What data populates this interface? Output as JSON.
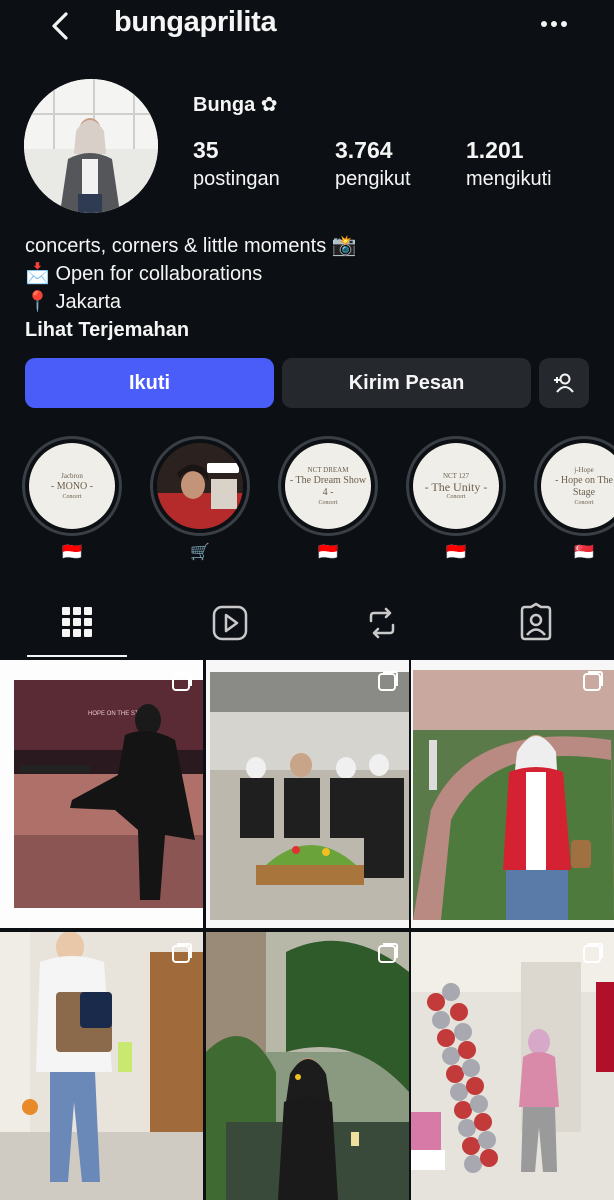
{
  "header": {
    "username": "bungaprilita"
  },
  "profile": {
    "display_name": "Bunga ✿",
    "stats": [
      {
        "value": "35",
        "label": "postingan"
      },
      {
        "value": "3.764",
        "label": "pengikut"
      },
      {
        "value": "1.201",
        "label": "mengikuti"
      }
    ],
    "bio": [
      "concerts, corners & little moments 📸",
      "📩 Open for collaborations",
      "📍 Jakarta"
    ],
    "translate_label": "Lihat Terjemahan"
  },
  "actions": {
    "follow_label": "Ikuti",
    "message_label": "Kirim Pesan"
  },
  "highlights": [
    {
      "l1": "Jacbron",
      "l2": "- MONO -",
      "l3": "Concert",
      "caption": "🇮🇩"
    },
    {
      "l1": "",
      "l2": "",
      "l3": "",
      "caption": "🛒"
    },
    {
      "l1": "NCT DREAM",
      "l2": "- The Dream Show 4 -",
      "l3": "Concert",
      "caption": "🇮🇩"
    },
    {
      "l1": "NCT 127",
      "l2": "- The Unity -",
      "l3": "Concert",
      "caption": "🇮🇩"
    },
    {
      "l1": "j-Hope",
      "l2": "- Hope on The Stage",
      "l3": "Concert",
      "caption": "🇸🇬"
    }
  ],
  "colors": {
    "background": "#0c1014",
    "accent": "#4a5df9",
    "button_secondary": "#25292e"
  },
  "tabs": [
    "grid-icon",
    "reels-icon",
    "reposts-icon",
    "tagged-icon"
  ],
  "grid_overlay_text": "HOPE ON THE STAGE"
}
